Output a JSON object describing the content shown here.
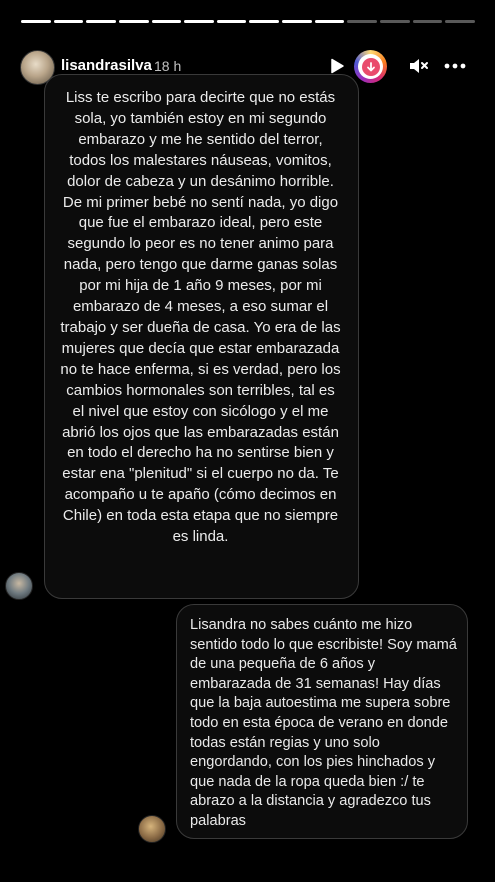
{
  "story": {
    "progress_segments_total": 14,
    "progress_segments_done": 10
  },
  "header": {
    "username": "lisandrasilva",
    "time": "18 h",
    "icons": [
      "play-icon",
      "music-icon",
      "mute-icon",
      "more-icon"
    ]
  },
  "messages": {
    "received": "Liss te escribo para decirte que no estás sola, yo también estoy en mi segundo embarazo y me he sentido del terror, todos los malestares náuseas, vomitos, dolor de cabeza y un desánimo horrible. De mi primer bebé no sentí nada, yo digo que fue el embarazo ideal, pero este segundo lo peor es no tener animo para nada, pero tengo que darme ganas solas por mi hija de 1 año 9 meses, por mi embarazo de 4 meses, a eso sumar el trabajo y ser dueña de casa. Yo era de las mujeres que decía que estar embarazada no te hace enferma, si es verdad, pero los cambios hormonales son terribles, tal es el nivel que estoy con sicólogo y el me abrió los ojos que las embarazadas están en todo el derecho ha no sentirse bien y estar ena \"plenitud\" si el cuerpo no da. Te acompaño u te apaño (cómo decimos en Chile) en toda esta etapa que no siempre es linda.",
    "reply": "Lisandra no sabes cuánto me hizo sentido todo lo que escribiste! Soy mamá de una pequeña de 6 años y embarazada de 31 semanas! Hay días que la baja autoestima me supera sobre todo en esta época de verano en donde todas están regias y uno solo engordando, con los pies hinchados y que nada de la ropa queda bien :/ te abrazo a la distancia y agradezco tus palabras"
  },
  "colors": {
    "background": "#000000",
    "bubble_border": "#3a3a3a",
    "music_accent": "#e94b6c"
  }
}
